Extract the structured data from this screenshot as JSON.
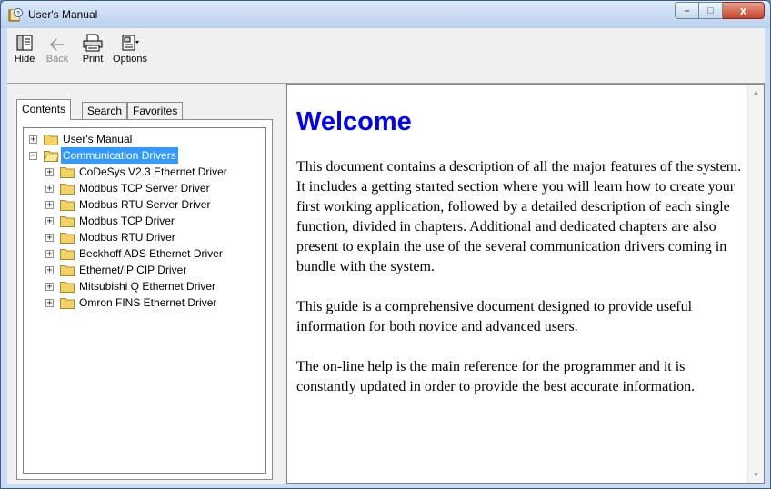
{
  "window": {
    "title": "User's Manual"
  },
  "window_buttons": {
    "minimize": "–",
    "maximize": "□",
    "close": "x"
  },
  "toolbar": {
    "hide": "Hide",
    "back": "Back",
    "print": "Print",
    "options": "Options"
  },
  "tabs": {
    "contents": "Contents",
    "search": "Search",
    "favorites": "Favorites"
  },
  "tree": {
    "items": [
      {
        "label": "User's Manual",
        "expander": "+",
        "level": 0,
        "open": false,
        "selected": false
      },
      {
        "label": "Communication Drivers",
        "expander": "−",
        "level": 0,
        "open": true,
        "selected": true
      },
      {
        "label": "CoDeSys V2.3 Ethernet Driver",
        "expander": "+",
        "level": 1,
        "open": false,
        "selected": false
      },
      {
        "label": "Modbus TCP Server Driver",
        "expander": "+",
        "level": 1,
        "open": false,
        "selected": false
      },
      {
        "label": "Modbus RTU Server Driver",
        "expander": "+",
        "level": 1,
        "open": false,
        "selected": false
      },
      {
        "label": "Modbus TCP Driver",
        "expander": "+",
        "level": 1,
        "open": false,
        "selected": false
      },
      {
        "label": "Modbus RTU Driver",
        "expander": "+",
        "level": 1,
        "open": false,
        "selected": false
      },
      {
        "label": "Beckhoff ADS Ethernet Driver",
        "expander": "+",
        "level": 1,
        "open": false,
        "selected": false
      },
      {
        "label": "Ethernet/IP CIP Driver",
        "expander": "+",
        "level": 1,
        "open": false,
        "selected": false
      },
      {
        "label": "Mitsubishi Q Ethernet Driver",
        "expander": "+",
        "level": 1,
        "open": false,
        "selected": false
      },
      {
        "label": "Omron FINS Ethernet Driver",
        "expander": "+",
        "level": 1,
        "open": false,
        "selected": false
      }
    ]
  },
  "document": {
    "heading": "Welcome",
    "paragraphs": [
      "This document contains a description of all the major features of the system. It includes a getting started section where you will learn how to create your first working application, followed by a detailed description of each single function, divided in chapters. Additional and dedicated chapters are also present to explain the use of the several communication drivers coming in bundle with the system.",
      "This guide is a comprehensive document designed to provide useful information for both novice and advanced users.",
      "The on-line help is the main reference for the programmer and it is constantly updated in order to provide the best accurate information."
    ]
  },
  "scrollbar": {
    "up": "▲",
    "down": "▼"
  },
  "colors": {
    "heading": "#0000ff",
    "selection": "#3399ff",
    "folder": "#f2d165",
    "window_frame": "#c9dcf2"
  }
}
